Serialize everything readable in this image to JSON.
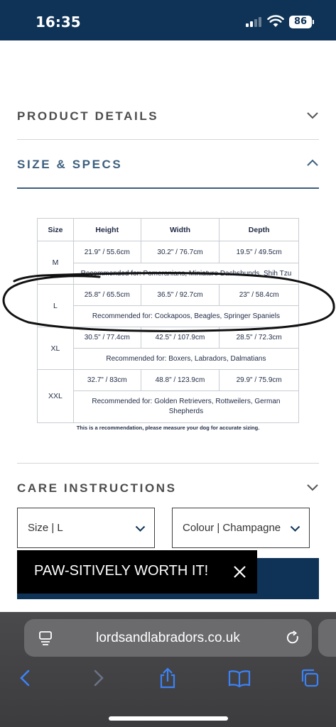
{
  "status_bar": {
    "time": "16:35",
    "battery": "86"
  },
  "accordion": {
    "product_details": "PRODUCT DETAILS",
    "size_specs": "SIZE & SPECS",
    "care_instructions": "CARE INSTRUCTIONS"
  },
  "size_table": {
    "headers": [
      "Size",
      "Height",
      "Width",
      "Depth"
    ],
    "rows": [
      {
        "size": "M",
        "height": "21.9\" / 55.6cm",
        "width": "30.2\" / 76.7cm",
        "depth": "19.5\" / 49.5cm",
        "recommended": "Recommended for: Pomeranians, Miniature Dachshunds, Shih Tzu"
      },
      {
        "size": "L",
        "height": "25.8\" / 65.5cm",
        "width": "36.5\" / 92.7cm",
        "depth": "23\" / 58.4cm",
        "recommended": "Recommended for: Cockapoos, Beagles, Springer Spaniels"
      },
      {
        "size": "XL",
        "height": "30.5\" / 77.4cm",
        "width": "42.5\" / 107.9cm",
        "depth": "28.5\" / 72.3cm",
        "recommended": "Recommended for: Boxers, Labradors, Dalmatians"
      },
      {
        "size": "XXL",
        "height": "32.7\" / 83cm",
        "width": "48.8\" / 123.9cm",
        "depth": "29.9\" / 75.9cm",
        "recommended": "Recommended for: Golden Retrievers, Rottweilers, German Shepherds"
      }
    ],
    "note": "This is a recommendation, please measure your dog for accurate sizing."
  },
  "selectors": {
    "size": "Size | L",
    "colour": "Colour | Champagne"
  },
  "toast": {
    "text": "PAW-SITIVELY WORTH IT!"
  },
  "browser": {
    "url": "lordsandlabradors.co.uk"
  },
  "colors": {
    "navy": "#0e3357",
    "accent_blue": "#3d5f7e",
    "ios_blue": "#3c82f6",
    "text_gray": "#555555"
  }
}
